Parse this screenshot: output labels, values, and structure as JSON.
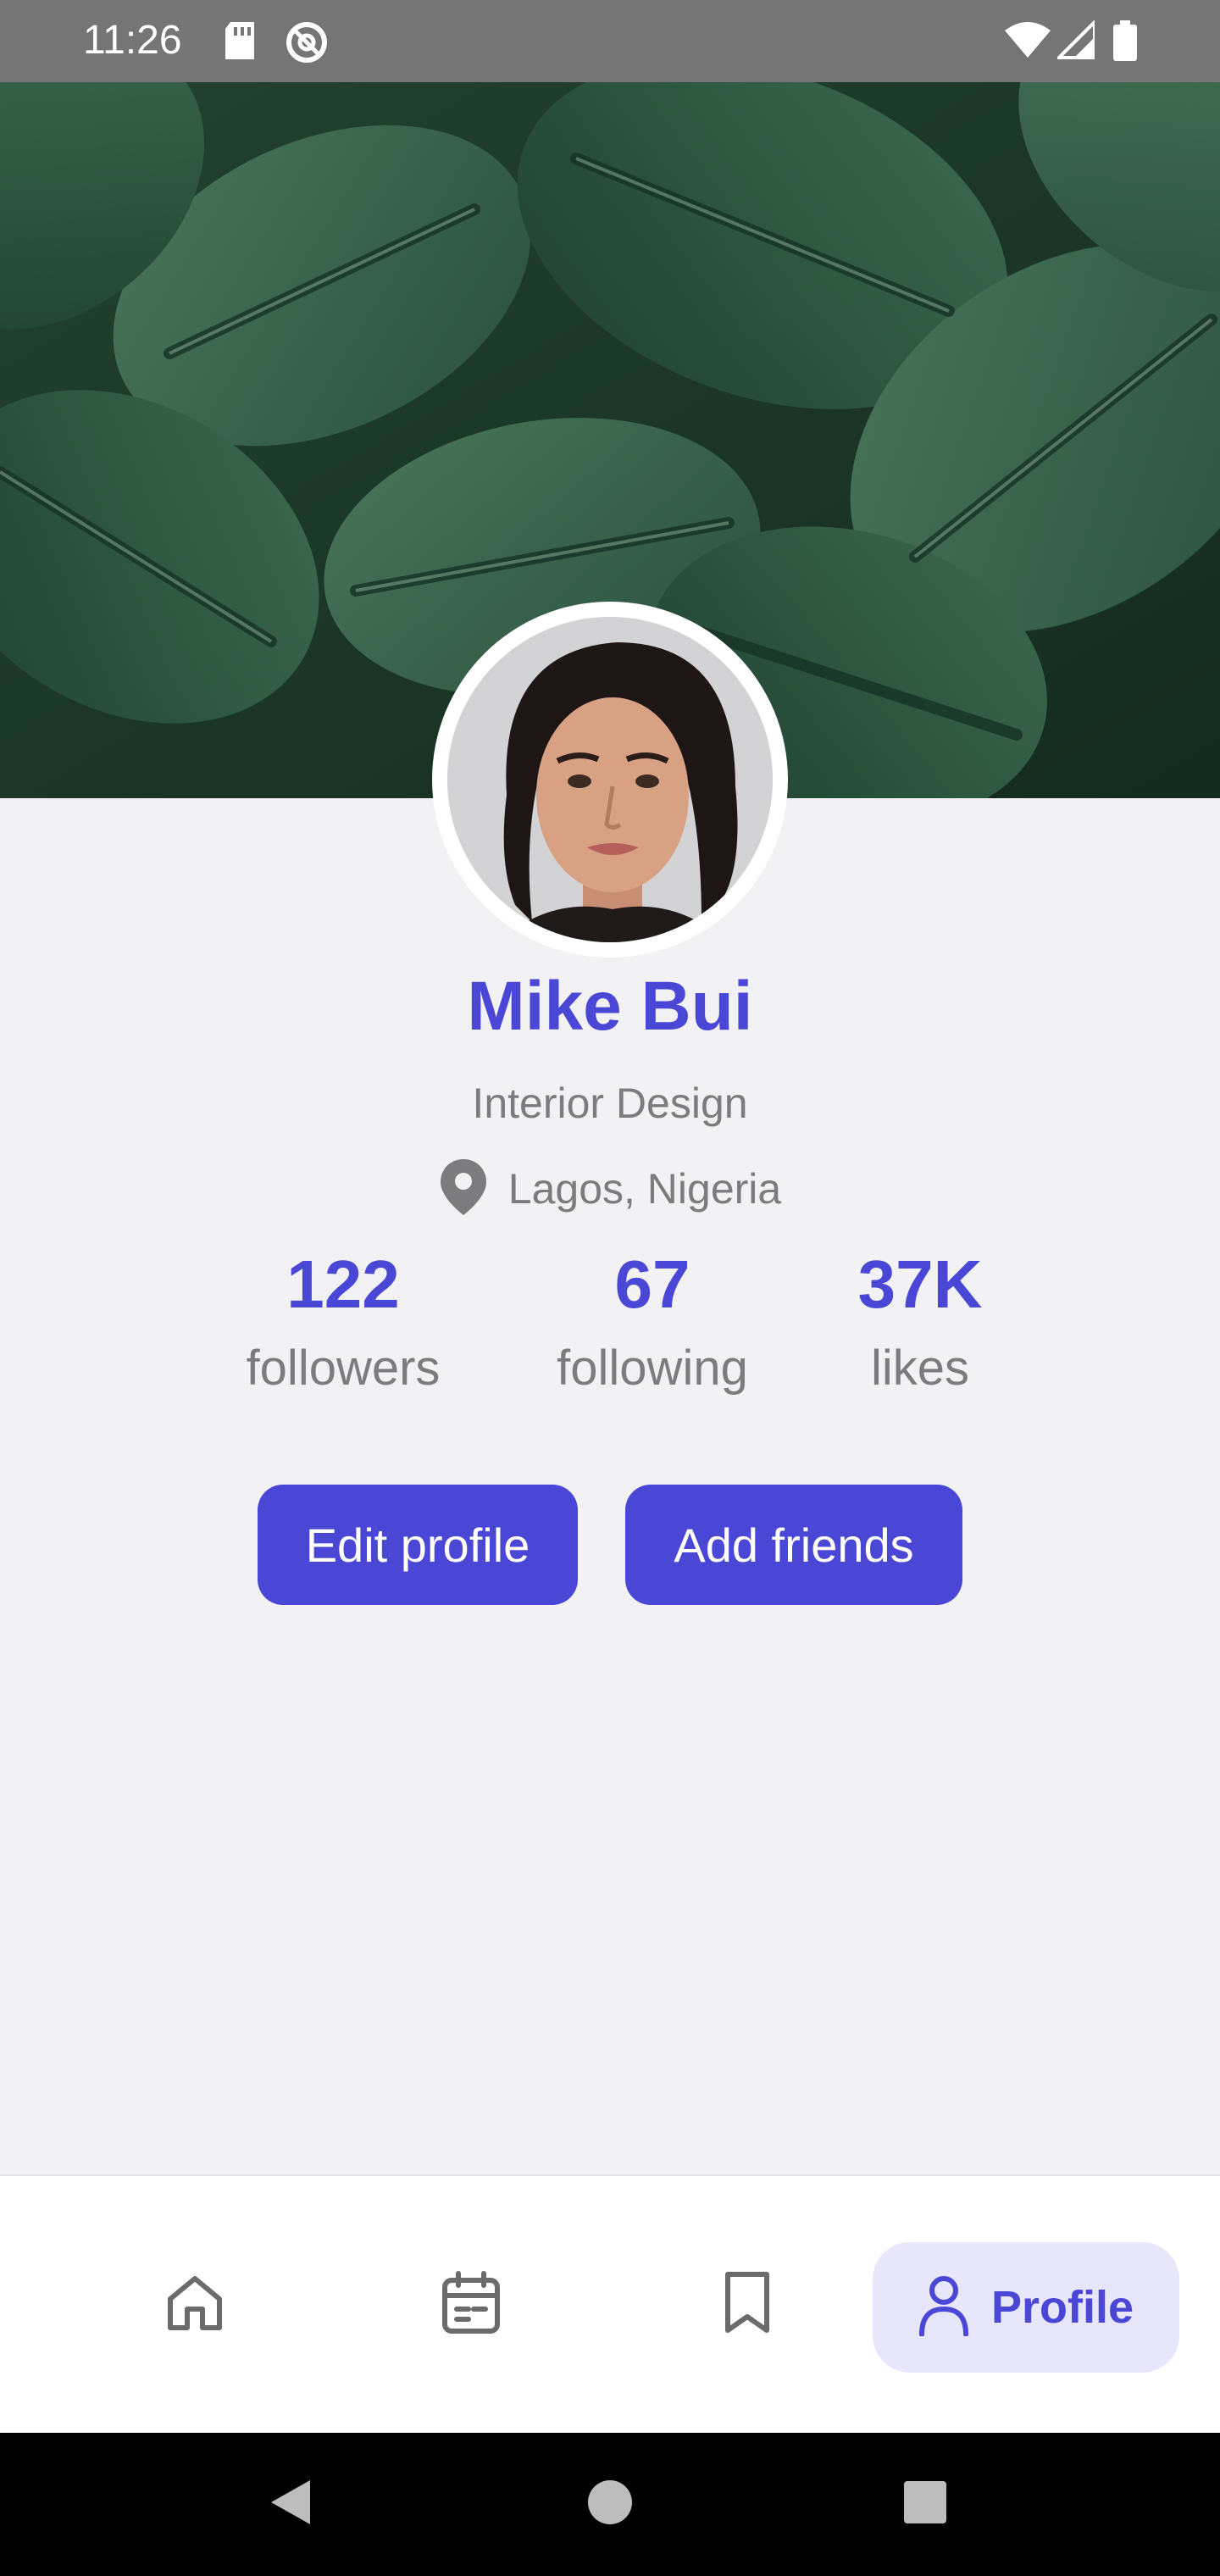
{
  "status_bar": {
    "time": "11:26"
  },
  "profile": {
    "name": "Mike Bui",
    "role": "Interior Design",
    "location": "Lagos, Nigeria"
  },
  "stats": [
    {
      "value": "122",
      "label": "followers"
    },
    {
      "value": "67",
      "label": "following"
    },
    {
      "value": "37K",
      "label": "likes"
    }
  ],
  "actions": {
    "edit_profile": "Edit profile",
    "add_friends": "Add friends"
  },
  "bottom_nav": {
    "items": [
      {
        "icon": "home-icon"
      },
      {
        "icon": "calendar-icon"
      },
      {
        "icon": "bookmark-icon"
      },
      {
        "icon": "person-icon",
        "label": "Profile",
        "active": true
      }
    ]
  },
  "colors": {
    "accent": "#4a47d6",
    "accent_bg": "#e7e6fb",
    "page_bg": "#f2f1f3",
    "text_muted": "#7c7c7f"
  }
}
